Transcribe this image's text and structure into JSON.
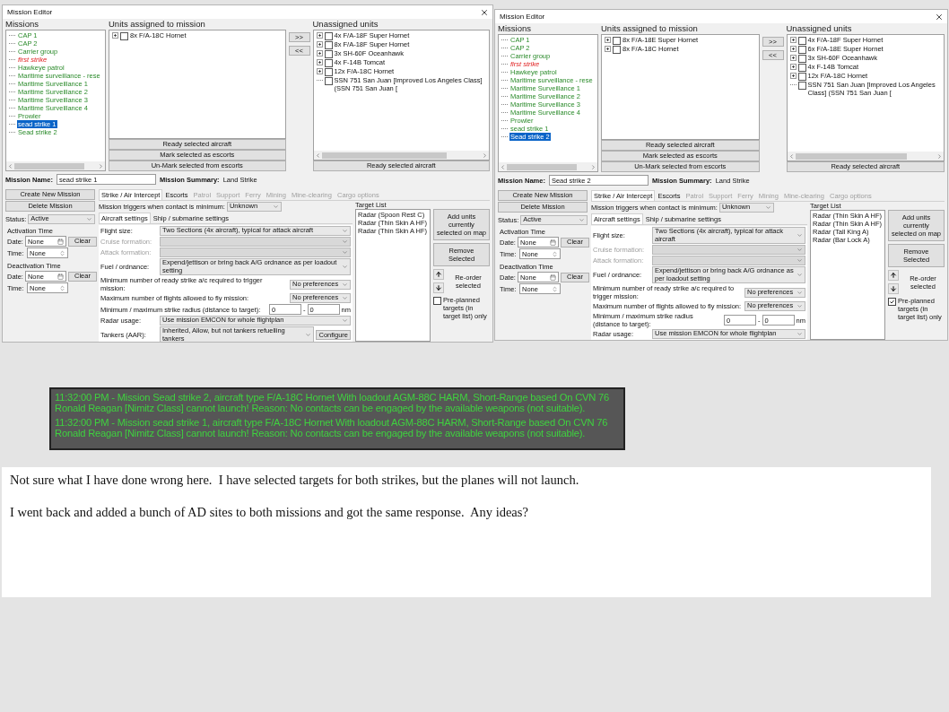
{
  "editors": [
    {
      "title": "Mission Editor",
      "missions_header": "Missions",
      "missions": [
        {
          "label": "CAP 1",
          "kind": "active",
          "selected": false
        },
        {
          "label": "CAP 2",
          "kind": "active",
          "selected": false
        },
        {
          "label": "Carrier group",
          "kind": "active",
          "selected": false
        },
        {
          "label": "first strike",
          "kind": "inactive",
          "selected": false
        },
        {
          "label": "Hawkeye patrol",
          "kind": "active",
          "selected": false
        },
        {
          "label": "Maritime surveillance - rese",
          "kind": "active",
          "selected": false
        },
        {
          "label": "Maritime Surveillance 1",
          "kind": "active",
          "selected": false
        },
        {
          "label": "Maritime Surveillance 2",
          "kind": "active",
          "selected": false
        },
        {
          "label": "Maritime Surveillance 3",
          "kind": "active",
          "selected": false
        },
        {
          "label": "Maritime Surveillance 4",
          "kind": "active",
          "selected": false
        },
        {
          "label": "Prowler",
          "kind": "active",
          "selected": false
        },
        {
          "label": "sead strike 1",
          "kind": "active",
          "selected": true
        },
        {
          "label": "Sead strike 2",
          "kind": "active",
          "selected": false
        }
      ],
      "assigned_header": "Units assigned to mission",
      "assigned_units": [
        {
          "label": "8x F/A-18C Hornet",
          "expandable": true,
          "checked": false
        }
      ],
      "assigned_buttons": [
        "Ready selected aircraft",
        "Mark selected as escorts",
        "Un-Mark selected from escorts"
      ],
      "move_buttons": [
        ">>",
        "<<"
      ],
      "unassigned_header": "Unassigned units",
      "unassigned_units": [
        {
          "label": "4x F/A-18F Super Hornet",
          "expandable": true,
          "checked": false
        },
        {
          "label": "8x F/A-18F Super Hornet",
          "expandable": true,
          "checked": false
        },
        {
          "label": "3x SH-60F Oceanhawk",
          "expandable": true,
          "checked": false
        },
        {
          "label": "4x F-14B Tomcat",
          "expandable": true,
          "checked": false
        },
        {
          "label": "12x F/A-18C Hornet",
          "expandable": true,
          "checked": false
        },
        {
          "label": "SSN 751 San Juan [Improved Los Angeles Class] (SSN 751 San Juan [",
          "expandable": false,
          "checked": false
        }
      ],
      "unassigned_button": "Ready selected aircraft",
      "mission_name_label": "Mission Name:",
      "mission_name": "sead strike 1",
      "summary_label": "Mission Summary:",
      "summary": "Land Strike",
      "mission_buttons": [
        "Create New Mission",
        "Delete Mission"
      ],
      "status_label": "Status:",
      "status": "Active",
      "time_groups": [
        {
          "title": "Activation Time",
          "date_label": "Date:",
          "date": "None",
          "clear": "Clear",
          "time_label": "Time:",
          "time": "None"
        },
        {
          "title": "Deactivation Time",
          "date_label": "Date:",
          "date": "None",
          "clear": "Clear",
          "time_label": "Time:",
          "time": "None"
        }
      ],
      "tabs": [
        {
          "label": "Strike / Air Intercept",
          "selected": true,
          "disabled": false
        },
        {
          "label": "Escorts",
          "selected": false,
          "disabled": false
        },
        {
          "label": "Patrol",
          "selected": false,
          "disabled": true
        },
        {
          "label": "Support",
          "selected": false,
          "disabled": true
        },
        {
          "label": "Ferry",
          "selected": false,
          "disabled": true
        },
        {
          "label": "Mining",
          "selected": false,
          "disabled": true
        },
        {
          "label": "Mine-clearing",
          "selected": false,
          "disabled": true
        },
        {
          "label": "Cargo options",
          "selected": false,
          "disabled": true
        }
      ],
      "trigger_label": "Mission triggers when contact is minimum:",
      "trigger": "Unknown",
      "subtabs": [
        {
          "label": "Aircraft settings",
          "selected": true
        },
        {
          "label": "Ship / submarine settings",
          "selected": false
        }
      ],
      "settings": [
        {
          "kind": "select",
          "label": "Flight size:",
          "value": "Two Sections (4x aircraft), typical for attack aircraft",
          "disabled": false
        },
        {
          "kind": "select",
          "label": "Cruise formation:",
          "disabled": true
        },
        {
          "kind": "select",
          "label": "Attack formation:",
          "disabled": true
        },
        {
          "kind": "select",
          "label": "Fuel / ordnance:",
          "value": "Expend/jettison or bring back A/G ordnance as per loadout setting",
          "disabled": false
        },
        {
          "kind": "wide_select",
          "label": "Minimum number of ready strike a/c required to trigger mission:",
          "value": "No preferences"
        },
        {
          "kind": "wide_select",
          "label": "Maximum number of flights allowed to fly mission:",
          "value": "No preferences"
        },
        {
          "kind": "range",
          "label": "Minimum / maximum strike radius (distance to target):",
          "min": "0",
          "separator": "-",
          "max": "0",
          "unit": "nm"
        },
        {
          "kind": "select",
          "label": "Radar usage:",
          "value": "Use mission EMCON for whole flightplan",
          "disabled": false
        },
        {
          "kind": "select_button",
          "label": "Tankers (AAR):",
          "value": "Inherited, Allow, but not tankers refuelling tankers",
          "button": "Configure"
        }
      ],
      "target_list_title": "Target List",
      "targets": [
        "Radar (Spoon Rest C)",
        "Radar (Thin Skin A HF)",
        "Radar (Thin Skin A HF)"
      ],
      "target_buttons": [
        "Add units currently selected on map",
        "Remove Selected"
      ],
      "reorder_label": "Re-order selected",
      "preplanned": {
        "label": "Pre-planned targets (in target list) only",
        "checked": false
      }
    },
    {
      "title": "Mission Editor",
      "missions_header": "Missions",
      "missions": [
        {
          "label": "CAP 1",
          "kind": "active",
          "selected": false
        },
        {
          "label": "CAP 2",
          "kind": "active",
          "selected": false
        },
        {
          "label": "Carrier group",
          "kind": "active",
          "selected": false
        },
        {
          "label": "first strike",
          "kind": "inactive",
          "selected": false
        },
        {
          "label": "Hawkeye patrol",
          "kind": "active",
          "selected": false
        },
        {
          "label": "Maritime surveillance - rese",
          "kind": "active",
          "selected": false
        },
        {
          "label": "Maritime Surveillance 1",
          "kind": "active",
          "selected": false
        },
        {
          "label": "Maritime Surveillance 2",
          "kind": "active",
          "selected": false
        },
        {
          "label": "Maritime Surveillance 3",
          "kind": "active",
          "selected": false
        },
        {
          "label": "Maritime Surveillance 4",
          "kind": "active",
          "selected": false
        },
        {
          "label": "Prowler",
          "kind": "active",
          "selected": false
        },
        {
          "label": "sead strike 1",
          "kind": "active",
          "selected": false
        },
        {
          "label": "Sead strike 2",
          "kind": "active",
          "selected": true
        }
      ],
      "assigned_header": "Units assigned to mission",
      "assigned_units": [
        {
          "label": "8x F/A-18E Super Hornet",
          "expandable": true,
          "checked": false
        },
        {
          "label": "8x F/A-18C Hornet",
          "expandable": true,
          "checked": false
        }
      ],
      "assigned_buttons": [
        "Ready selected aircraft",
        "Mark selected as escorts",
        "Un-Mark selected from escorts"
      ],
      "move_buttons": [
        ">>",
        "<<"
      ],
      "unassigned_header": "Unassigned units",
      "unassigned_units": [
        {
          "label": "4x F/A-18F Super Hornet",
          "expandable": true,
          "checked": false
        },
        {
          "label": "6x F/A-18E Super Hornet",
          "expandable": true,
          "checked": false
        },
        {
          "label": "3x SH-60F Oceanhawk",
          "expandable": true,
          "checked": false
        },
        {
          "label": "4x F-14B Tomcat",
          "expandable": true,
          "checked": false
        },
        {
          "label": "12x F/A-18C Hornet",
          "expandable": true,
          "checked": false
        },
        {
          "label": "SSN 751 San Juan [Improved Los Angeles Class] (SSN 751 San Juan [",
          "expandable": false,
          "checked": false
        }
      ],
      "unassigned_button": "Ready selected aircraft",
      "mission_name_label": "Mission Name:",
      "mission_name": "Sead strike 2",
      "summary_label": "Mission Summary:",
      "summary": "Land Strike",
      "mission_buttons": [
        "Create New Mission",
        "Delete Mission"
      ],
      "status_label": "Status:",
      "status": "Active",
      "time_groups": [
        {
          "title": "Activation Time",
          "date_label": "Date:",
          "date": "None",
          "clear": "Clear",
          "time_label": "Time:",
          "time": "None"
        },
        {
          "title": "Deactivation Time",
          "date_label": "Date:",
          "date": "None",
          "clear": "Clear",
          "time_label": "Time:",
          "time": "None"
        }
      ],
      "tabs": [
        {
          "label": "Strike / Air Intercept",
          "selected": true,
          "disabled": false
        },
        {
          "label": "Escorts",
          "selected": false,
          "disabled": false
        },
        {
          "label": "Patrol",
          "selected": false,
          "disabled": true
        },
        {
          "label": "Support",
          "selected": false,
          "disabled": true
        },
        {
          "label": "Ferry",
          "selected": false,
          "disabled": true
        },
        {
          "label": "Mining",
          "selected": false,
          "disabled": true
        },
        {
          "label": "Mine-clearing",
          "selected": false,
          "disabled": true
        },
        {
          "label": "Cargo options",
          "selected": false,
          "disabled": true
        }
      ],
      "trigger_label": "Mission triggers when contact is minimum:",
      "trigger": "Unknown",
      "subtabs": [
        {
          "label": "Aircraft settings",
          "selected": true
        },
        {
          "label": "Ship / submarine settings",
          "selected": false
        }
      ],
      "settings": [
        {
          "kind": "select",
          "label": "Flight size:",
          "value": "Two Sections (4x aircraft), typical for attack aircraft",
          "disabled": false
        },
        {
          "kind": "select",
          "label": "Cruise formation:",
          "disabled": true
        },
        {
          "kind": "select",
          "label": "Attack formation:",
          "disabled": true
        },
        {
          "kind": "select",
          "label": "Fuel / ordnance:",
          "value": "Expend/jettison or bring back A/G ordnance as per loadout setting",
          "disabled": false
        },
        {
          "kind": "wide_select",
          "label": "Minimum number of ready strike a/c required to trigger mission:",
          "value": "No preferences"
        },
        {
          "kind": "wide_select",
          "label": "Maximum number of flights allowed to fly mission:",
          "value": "No preferences"
        },
        {
          "kind": "range",
          "label": "Minimum / maximum strike radius (distance to target):",
          "min": "0",
          "separator": "-",
          "max": "0",
          "unit": "nm"
        },
        {
          "kind": "select",
          "label": "Radar usage:",
          "value": "Use mission EMCON for whole flightplan",
          "disabled": false
        }
      ],
      "target_list_title": "Target List",
      "targets": [
        "Radar (Thin Skin A HF)",
        "Radar (Thin Skin A HF)",
        "Radar (Tall King A)",
        "Radar (Bar Lock A)"
      ],
      "target_buttons": [
        "Add units currently selected on map",
        "Remove Selected"
      ],
      "reorder_label": "Re-order selected",
      "preplanned": {
        "label": "Pre-planned targets (in target list) only",
        "checked": true
      }
    }
  ],
  "messages": [
    "11:32:00 PM - Mission Sead strike 2, aircraft type F/A-18C Hornet With loadout AGM-88C HARM, Short-Range based On CVN 76 Ronald Reagan [Nimitz Class] cannot launch! Reason: No contacts can be engaged by the available weapons (not suitable).",
    "11:32:00 PM - Mission sead strike 1, aircraft type F/A-18C Hornet With loadout AGM-88C HARM, Short-Range based On CVN 76 Ronald Reagan [Nimitz Class] cannot launch! Reason: No contacts can be engaged by the available weapons (not suitable)."
  ],
  "post": [
    "Not sure what I have done wrong here.  I have selected targets for both strikes, but the planes will not launch.",
    "I went back and added a bunch of AD sites to both missions and got the same response.  Any ideas?"
  ]
}
